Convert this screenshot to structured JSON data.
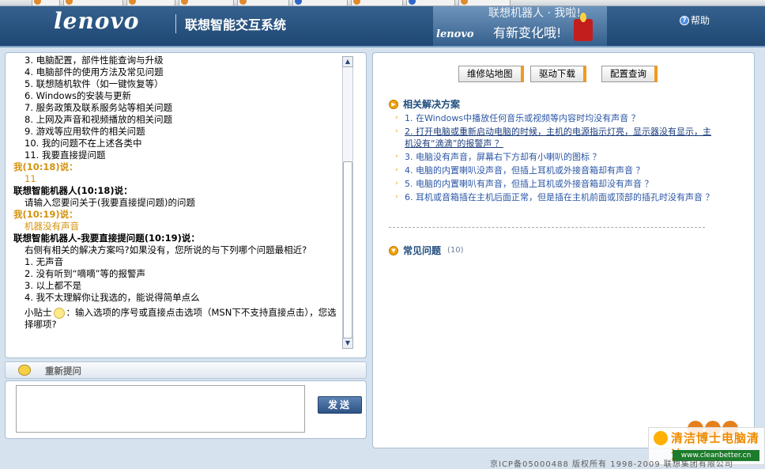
{
  "taskbar": {
    "items": [
      "",
      "",
      "",
      "",
      "",
      "",
      "",
      "",
      ""
    ]
  },
  "header": {
    "logo": "lenovo",
    "title": "联想智能交互系统",
    "banner_logo": "lenovo",
    "banner_line1": "联想机器人 · 我啦!",
    "banner_line2": "有新变化哦!",
    "help_label": "帮助"
  },
  "chat": {
    "menu_items": [
      "3. 电脑配置，部件性能查询与升级",
      "4. 电脑部件的使用方法及常见问题",
      "5. 联想随机软件（如一键恢复等）",
      "6. Windows的安装与更新",
      "7. 服务政策及联系服务站等相关问题",
      "8. 上网及声音和视频播放的相关问题",
      "9. 游戏等应用软件的相关问题",
      "10. 我的问题不在上述各类中",
      "11. 我要直接提问题"
    ],
    "user1_header": "我(10:18)说：",
    "user1_msg": "11",
    "robot1_header": "联想智能机器人(10:18)说：",
    "robot1_msg": "请输入您要问关于(我要直接提问题)的问题",
    "user2_header": "我(10:19)说：",
    "user2_msg": "机器没有声音",
    "robot2_header": "联想智能机器人-我要直接提问题(10:19)说：",
    "robot2_msg": "右侧有相关的解决方案吗?如果没有，您所说的与下列哪个问题最相近?",
    "options": [
      "1. 无声音",
      "2. 没有听到“嘀嘀”等的报警声",
      "3. 以上都不是",
      "4. 我不太理解你让我选的，能说得简单点么"
    ],
    "tip_label": "小贴士",
    "tip_text": "：输入选项的序号或直接点击选项（MSN下不支持直接点击），您选择哪项?"
  },
  "retype": {
    "label": "重新提问"
  },
  "input": {
    "value": "",
    "send_label": "发送"
  },
  "right": {
    "buttons": [
      "维修站地图",
      "驱动下载",
      "配置查询"
    ],
    "solutions_title": "相关解决方案",
    "solutions": [
      "1. 在Windows中播放任何音乐或视频等内容时均没有声音 ？",
      "2. 打开电脑或重新启动电脑的时候，主机的电源指示灯亮，显示器没有显示，主机没有“滴滴”的报警声 ？",
      "3. 电脑没有声音，屏幕右下方却有小喇叭的图标 ？",
      "4. 电脑的内置喇叭没声音，但插上耳机或外接音箱却有声音 ？",
      "5. 电脑的内置喇叭有声音，但插上耳机或外接音箱却没有声音 ？",
      "6. 耳机或音箱插在主机后面正常，但是插在主机前面或顶部的插孔时没有声音 ？"
    ],
    "faq_title": "常见问题",
    "faq_count": "(10)"
  },
  "watermark": {
    "title": "清洁博士电脑清洁",
    "url": "www.cleanbetter.cn"
  },
  "footer": {
    "text": "京ICP备05000488 版权所有 1998-2009 联想集团有限公司"
  },
  "colors": {
    "header_bg": "#2a5480",
    "accent_orange": "#f0a30a",
    "link_blue": "#2a56a6",
    "user_text": "#d4920e"
  }
}
